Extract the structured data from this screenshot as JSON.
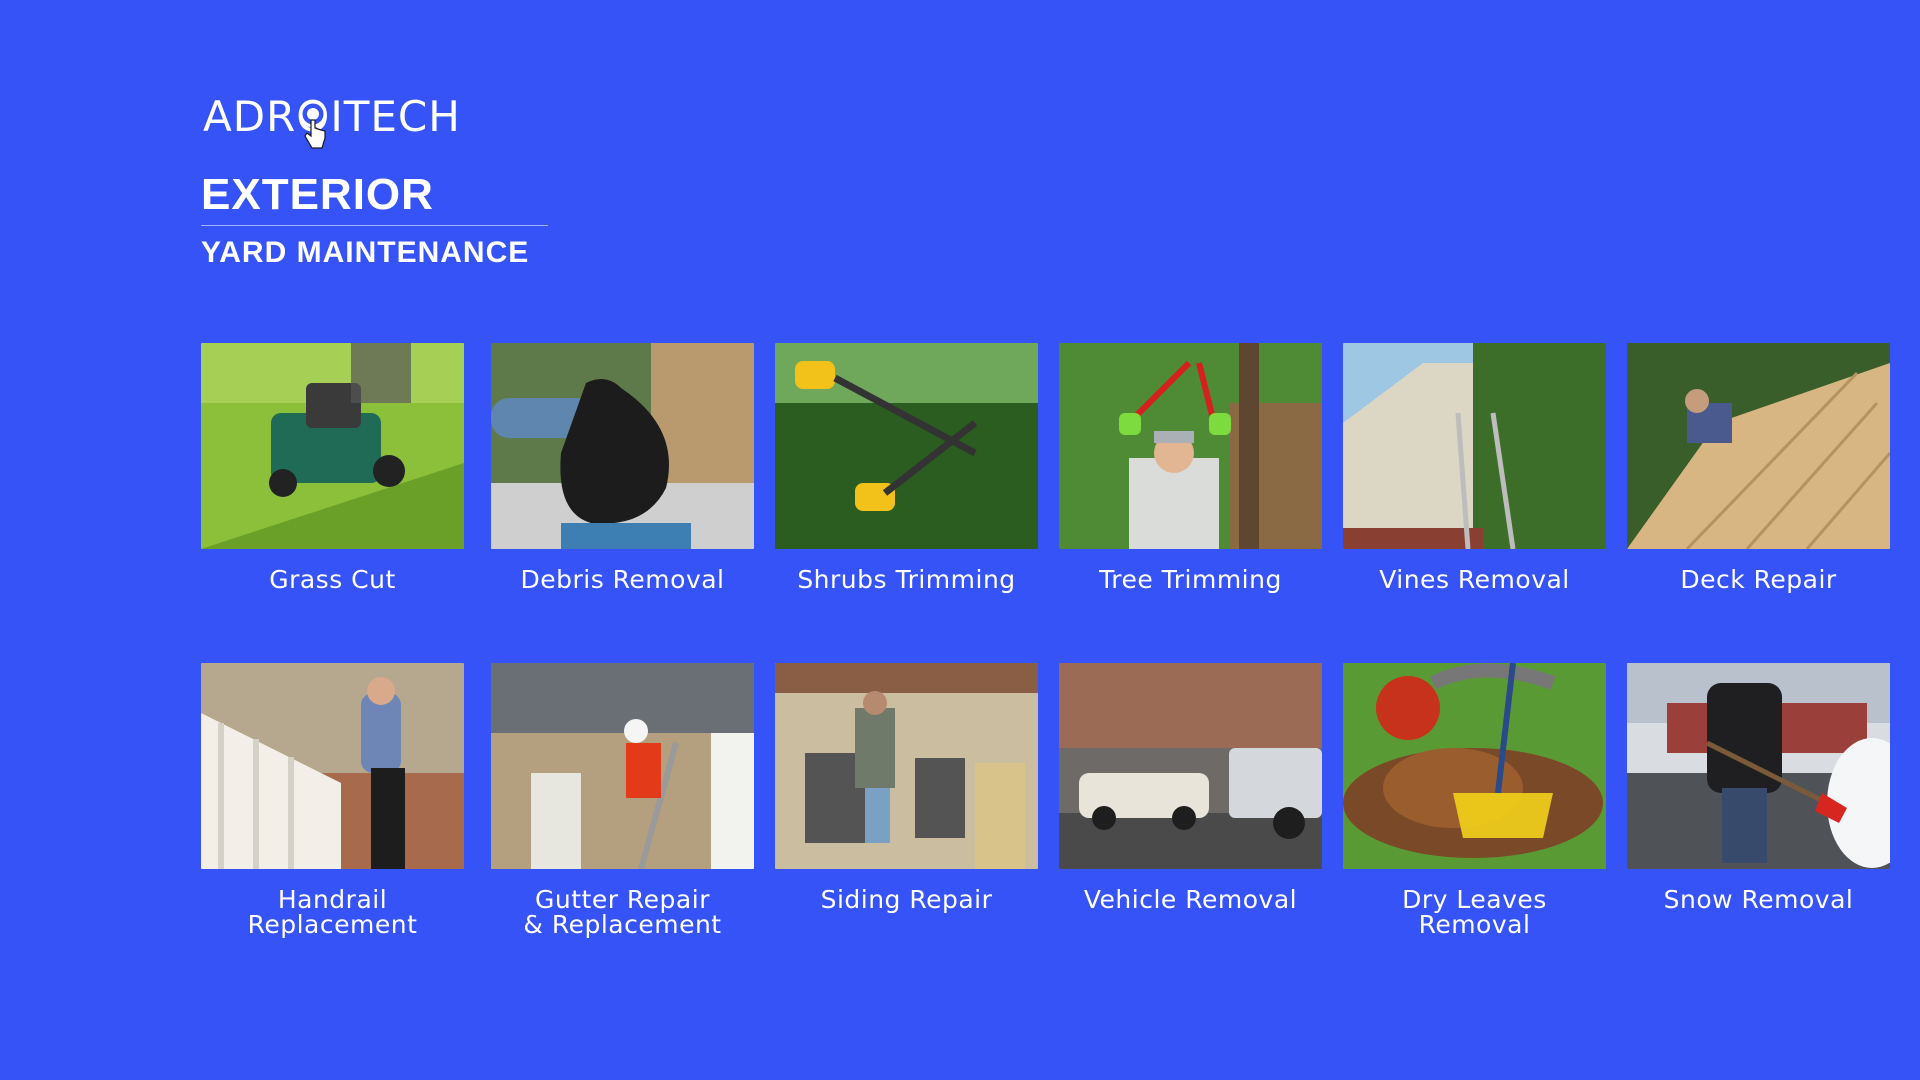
{
  "brand": {
    "logo_text": "ADROITECH",
    "logo_icon": "pointer-hand-icon"
  },
  "header": {
    "title": "EXTERIOR",
    "subtitle": "YARD MAINTENANCE"
  },
  "services": [
    {
      "label": "Grass Cut",
      "image": "lawn-mower-photo"
    },
    {
      "label": "Debris Removal",
      "image": "trash-bag-photo"
    },
    {
      "label": "Shrubs Trimming",
      "image": "hedge-shears-photo"
    },
    {
      "label": "Tree Trimming",
      "image": "tree-loppers-photo"
    },
    {
      "label": "Vines Removal",
      "image": "ivy-wall-ladder-photo"
    },
    {
      "label": "Deck Repair",
      "image": "wooden-deck-photo"
    },
    {
      "label": "Handrail\nReplacement",
      "image": "porch-handrail-photo"
    },
    {
      "label": "Gutter Repair\n& Replacement",
      "image": "gutter-ladder-photo"
    },
    {
      "label": "Siding Repair",
      "image": "house-siding-photo"
    },
    {
      "label": "Vehicle Removal",
      "image": "tow-truck-photo"
    },
    {
      "label": "Dry Leaves\nRemoval",
      "image": "leaf-rake-photo"
    },
    {
      "label": "Snow Removal",
      "image": "snow-shovel-photo"
    }
  ],
  "colors": {
    "background": "#3653f8",
    "text": "#ffffff"
  }
}
